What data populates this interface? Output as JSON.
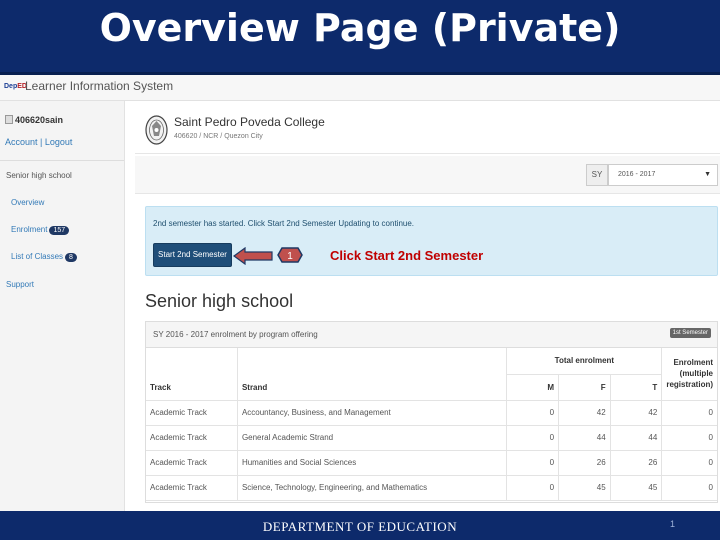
{
  "slide": {
    "title": "Overview Page (Private)",
    "footer": "Department of Education",
    "footer_display": "DEPARTMENT OF EDUCATION",
    "page_number": "1"
  },
  "app": {
    "logo_text_a": "Dep",
    "logo_text_b": "ED",
    "name": "Learner Information System"
  },
  "sidebar": {
    "username": "406620sain",
    "account_link": "Account | Logout",
    "section": "Senior high school",
    "items": [
      {
        "label": "Overview"
      },
      {
        "label": "Enrolment",
        "badge": "157"
      },
      {
        "label": "List of Classes",
        "badge": "8"
      }
    ],
    "support": "Support"
  },
  "school": {
    "name": "Saint Pedro Poveda College",
    "location": "406620 / NCR / Quezon City"
  },
  "sy": {
    "label": "SY",
    "value": "2016 - 2017"
  },
  "alert": {
    "message": "2nd semester has started. Click Start 2nd Semester Updating to continue.",
    "button": "Start 2nd Semester",
    "step": "1",
    "callout": "Click Start 2nd Semester"
  },
  "section_title": "Senior high school",
  "panel": {
    "title": "SY 2016 - 2017 enrolment by program offering",
    "semester_label": "1st Semester",
    "headers": {
      "track": "Track",
      "strand": "Strand",
      "total": "Total enrolment",
      "m": "M",
      "f": "F",
      "t": "T",
      "reg_a": "Enrolment",
      "reg_b": "(multiple",
      "reg_c": "registration)"
    },
    "rows": [
      {
        "track": "Academic Track",
        "strand": "Accountancy, Business, and Management",
        "m": "0",
        "f": "42",
        "t": "42",
        "reg": "0"
      },
      {
        "track": "Academic Track",
        "strand": "General Academic Strand",
        "m": "0",
        "f": "44",
        "t": "44",
        "reg": "0"
      },
      {
        "track": "Academic Track",
        "strand": "Humanities and Social Sciences",
        "m": "0",
        "f": "26",
        "t": "26",
        "reg": "0"
      },
      {
        "track": "Academic Track",
        "strand": "Science, Technology, Engineering, and Mathematics",
        "m": "0",
        "f": "45",
        "t": "45",
        "reg": "0"
      }
    ]
  },
  "colors": {
    "slide_blue": "#0d2a6b",
    "alert_bg": "#d9edf7",
    "button": "#1f4e79",
    "callout_red": "#c00000"
  }
}
